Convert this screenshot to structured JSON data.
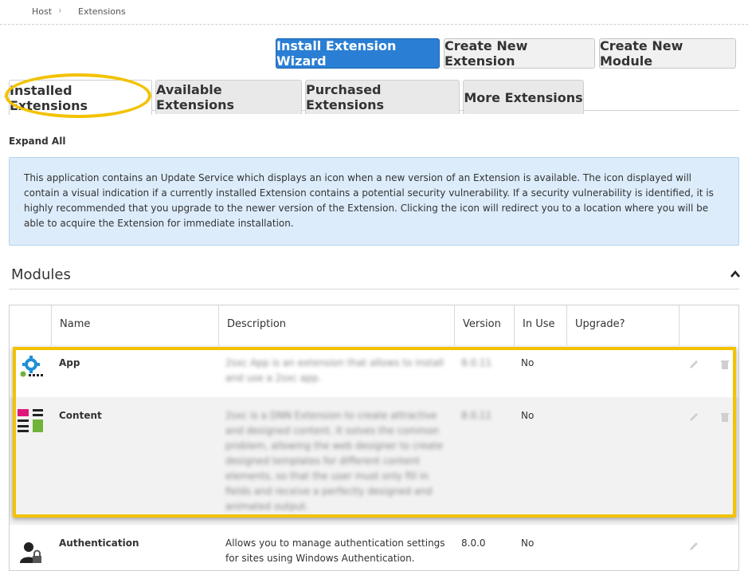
{
  "breadcrumb": {
    "items": [
      "Host",
      "Extensions"
    ]
  },
  "toolbar": {
    "install_wizard": "Install Extension Wizard",
    "create_extension": "Create New Extension",
    "create_module": "Create New Module"
  },
  "tabs": [
    {
      "label": "Installed Extensions",
      "active": true
    },
    {
      "label": "Available Extensions"
    },
    {
      "label": "Purchased Extensions"
    },
    {
      "label": "More Extensions"
    }
  ],
  "expand_all": "Expand All",
  "info": {
    "text": "This application contains an Update Service which displays an icon when a new version of an Extension is available. The icon displayed will contain a visual indication if a currently installed Extension contains a potential security vulnerability. If a security vulnerability is identified, it is highly recommended that you upgrade to the newer version of the Extension. Clicking the icon will redirect you to a location where you will be able to acquire the Extension for immediate installation."
  },
  "section": {
    "title": "Modules"
  },
  "table": {
    "headers": [
      "Name",
      "Description",
      "Version",
      "In Use",
      "Upgrade?"
    ],
    "rows": [
      {
        "name": "App",
        "description": "2sxc App is an extension that allows to install and use a 2sxc app.",
        "version": "8.0.11",
        "in_use": "No",
        "icon": "app-gear-icon"
      },
      {
        "name": "Content",
        "description": "2sxc is a DNN Extension to create attractive and designed content. It solves the common problem, allowing the web designer to create designed templates for different content elements, so that the user must only fill in fields and receive a perfectly designed and animated output.",
        "version": "8.0.11",
        "in_use": "No",
        "icon": "content-blocks-icon"
      },
      {
        "name": "Authentication",
        "description": "Allows you to manage authentication settings for sites using Windows Authentication.",
        "version": "8.0.0",
        "in_use": "No",
        "icon": "user-lock-icon"
      }
    ]
  },
  "colors": {
    "primary": "#2a7fd4",
    "highlight": "#f3c200",
    "info_bg": "#dcecfb"
  }
}
